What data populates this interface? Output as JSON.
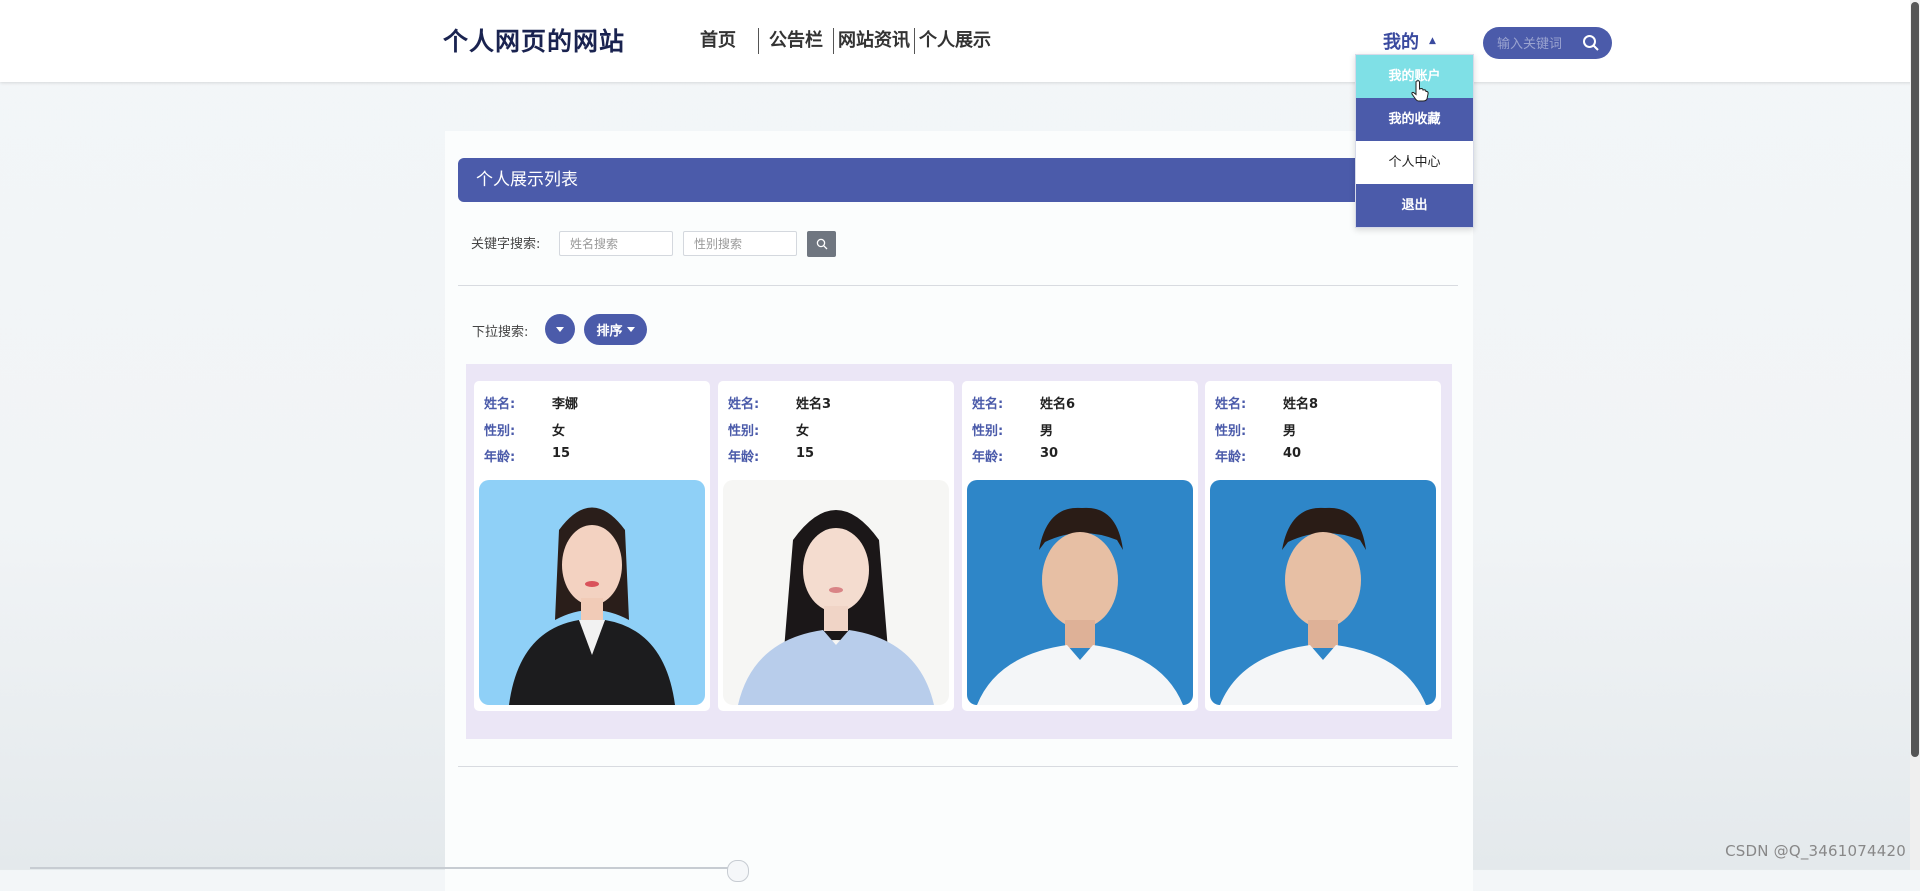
{
  "header": {
    "brand": "个人网页的网站",
    "nav": [
      "首页",
      "公告栏",
      "网站资讯",
      "个人展示"
    ],
    "mine_label": "我的",
    "search_placeholder": "输入关键词"
  },
  "dropdown": {
    "items": [
      "我的账户",
      "我的收藏",
      "个人中心",
      "退出"
    ]
  },
  "main": {
    "title": "个人展示列表",
    "keyword_label": "关键字搜索:",
    "name_placeholder": "姓名搜索",
    "gender_placeholder": "性别搜索",
    "dropdown_label": "下拉搜索:",
    "sort_label": "排序"
  },
  "field_labels": {
    "name": "姓名:",
    "gender": "性别:",
    "age": "年龄:"
  },
  "cards": [
    {
      "name": "李娜",
      "gender": "女",
      "age": "15"
    },
    {
      "name": "姓名3",
      "gender": "女",
      "age": "15"
    },
    {
      "name": "姓名6",
      "gender": "男",
      "age": "30"
    },
    {
      "name": "姓名8",
      "gender": "男",
      "age": "40"
    }
  ],
  "watermark": "CSDN @Q_3461074420",
  "colors": {
    "accent": "#4b5baa",
    "hover": "#7fe0e6",
    "cards_bg": "#ebe6f6"
  }
}
